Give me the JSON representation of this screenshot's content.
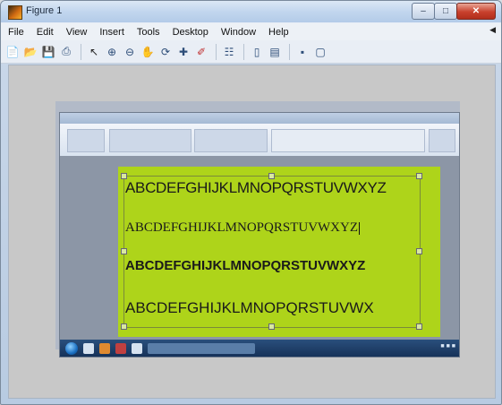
{
  "window": {
    "title": "Figure 1"
  },
  "menu": {
    "items": [
      "File",
      "Edit",
      "View",
      "Insert",
      "Tools",
      "Desktop",
      "Window",
      "Help"
    ]
  },
  "toolbar": {
    "buttons": [
      "new-figure-icon",
      "open-icon",
      "save-icon",
      "print-icon",
      "pointer-icon",
      "zoom-in-icon",
      "zoom-out-icon",
      "pan-icon",
      "rotate-icon",
      "data-cursor-icon",
      "brush-icon",
      "link-icon",
      "colorbar-icon",
      "legend-icon",
      "hide-tools-icon",
      "show-tools-icon"
    ]
  },
  "document": {
    "lines": [
      "ABCDEFGHIJKLMNOPQRSTUVWXYZ",
      "ABCDEFGHIJKLMNOPQRSTUVWXYZ",
      "ABCDEFGHIJKLMNOPQRSTUVWXYZ",
      "ABCDEFGHIJKLMNOPQRSTUVWX"
    ],
    "page_color": "#aed41a"
  },
  "colors": {
    "titlebar": "#c2d6ee",
    "figure_bg": "#c8c8c8",
    "taskbar": "#1e3f6a"
  }
}
